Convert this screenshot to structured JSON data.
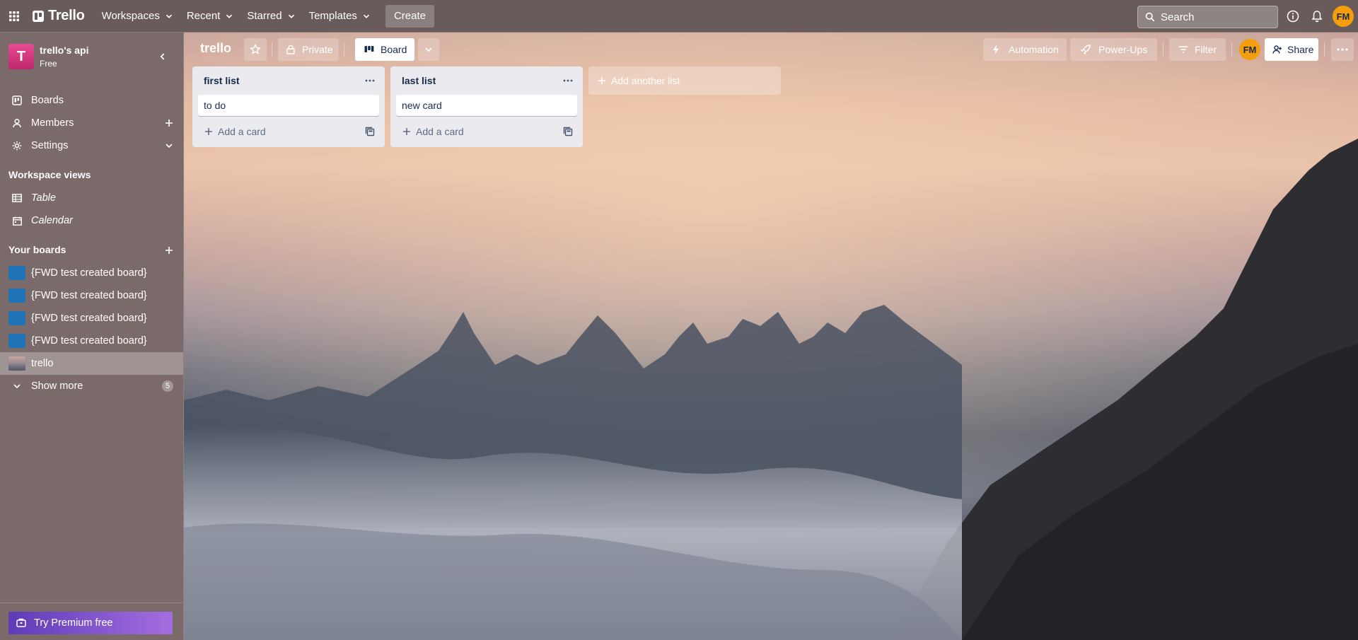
{
  "topbar": {
    "logo": "Trello",
    "menus": [
      "Workspaces",
      "Recent",
      "Starred",
      "Templates"
    ],
    "create_label": "Create",
    "search_placeholder": "Search",
    "avatar_initials": "FM"
  },
  "sidebar": {
    "workspace_initial": "T",
    "workspace_name": "trello's api",
    "workspace_plan": "Free",
    "nav": [
      {
        "label": "Boards"
      },
      {
        "label": "Members"
      },
      {
        "label": "Settings"
      }
    ],
    "views_heading": "Workspace views",
    "views": [
      {
        "label": "Table"
      },
      {
        "label": "Calendar"
      }
    ],
    "boards_heading": "Your boards",
    "boards": [
      {
        "label": "{FWD test created board}"
      },
      {
        "label": "{FWD test created board}"
      },
      {
        "label": "{FWD test created board}"
      },
      {
        "label": "{FWD test created board}"
      },
      {
        "label": "trello"
      }
    ],
    "show_more_label": "Show more",
    "show_more_count": "5",
    "premium_label": "Try Premium free"
  },
  "board": {
    "title": "trello",
    "visibility_label": "Private",
    "view_label": "Board",
    "automation_label": "Automation",
    "powerups_label": "Power-Ups",
    "filter_label": "Filter",
    "member_initials": "FM",
    "share_label": "Share",
    "lists": [
      {
        "title": "first list",
        "cards": [
          "to do"
        ],
        "add_card_label": "Add a card"
      },
      {
        "title": "last list",
        "cards": [
          "new card"
        ],
        "add_card_label": "Add a card"
      }
    ],
    "add_list_label": "Add another list"
  },
  "colors": {
    "topbar_bg": "#6a5b5b",
    "sidebar_bg": "#7b6a6a",
    "list_bg": "#eaeaef",
    "avatar_bg": "#f59e0b",
    "board_thumb": "#1f73b7",
    "premium_gradient": [
      "#5e3bb7",
      "#a46ee0"
    ]
  }
}
